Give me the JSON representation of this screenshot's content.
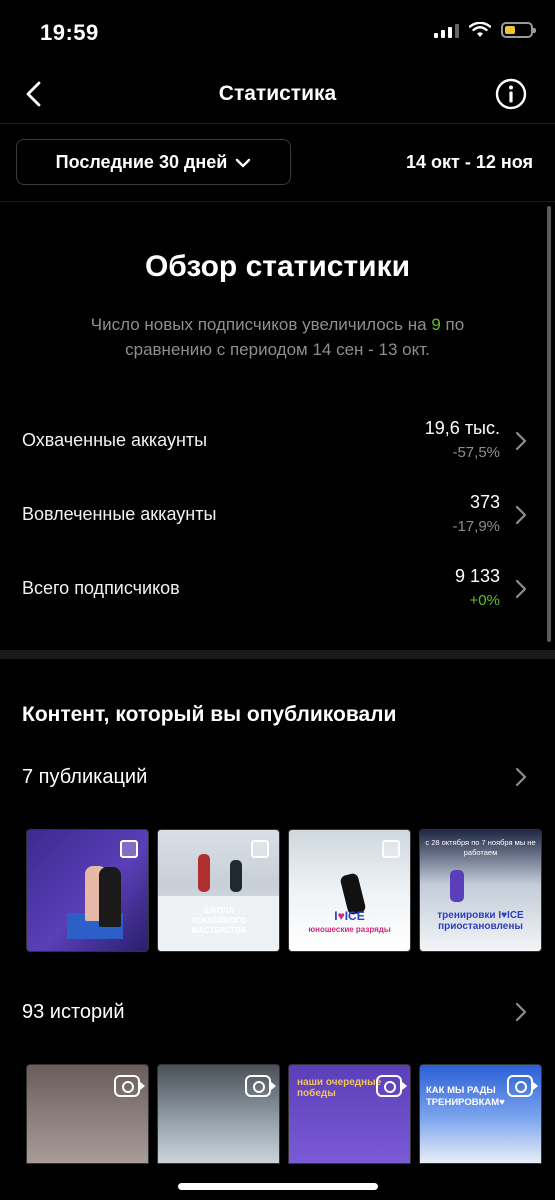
{
  "status_bar": {
    "time": "19:59"
  },
  "header": {
    "title": "Статистика"
  },
  "date_range": {
    "selector_label": "Последние 30 дней",
    "span": "14 окт - 12 ноя"
  },
  "overview": {
    "title": "Обзор статистики",
    "subtitle_prefix": "Число новых подписчиков увеличилось на",
    "subtitle_value": "9",
    "subtitle_suffix": "по сравнению с периодом 14 сен - 13 окт.",
    "metrics": [
      {
        "label": "Охваченные аккаунты",
        "value": "19,6 тыс.",
        "delta": "-57,5%"
      },
      {
        "label": "Вовлеченные аккаунты",
        "value": "373",
        "delta": "-17,9%"
      },
      {
        "label": "Всего подписчиков",
        "value": "9 133",
        "delta": "+0%"
      }
    ]
  },
  "content": {
    "title": "Контент, который вы опубликовали",
    "posts_label": "7 публикаций",
    "stories_label": "93 историй",
    "post_thumbs": [
      {
        "text": ""
      },
      {
        "text": "ШКОЛА ХОККЕЙНОГО МАСТЕРСТВА"
      },
      {
        "text_a": "I",
        "text_heart": "♥",
        "text_b": "ICE",
        "text_c": "юношеские разряды"
      },
      {
        "top": "с 28 октября по 7 ноября мы не работаем",
        "logo": "тренировки I♥ICE приостановлены"
      }
    ],
    "story_thumbs": [
      {
        "text": ""
      },
      {
        "text": ""
      },
      {
        "text": "наши очередные победы"
      },
      {
        "text": "КАК МЫ РАДЫ ТРЕНИРОВКАМ♥"
      }
    ]
  },
  "colors": {
    "positive": "#58c322",
    "muted": "#8e8e8e",
    "background": "#000000"
  }
}
